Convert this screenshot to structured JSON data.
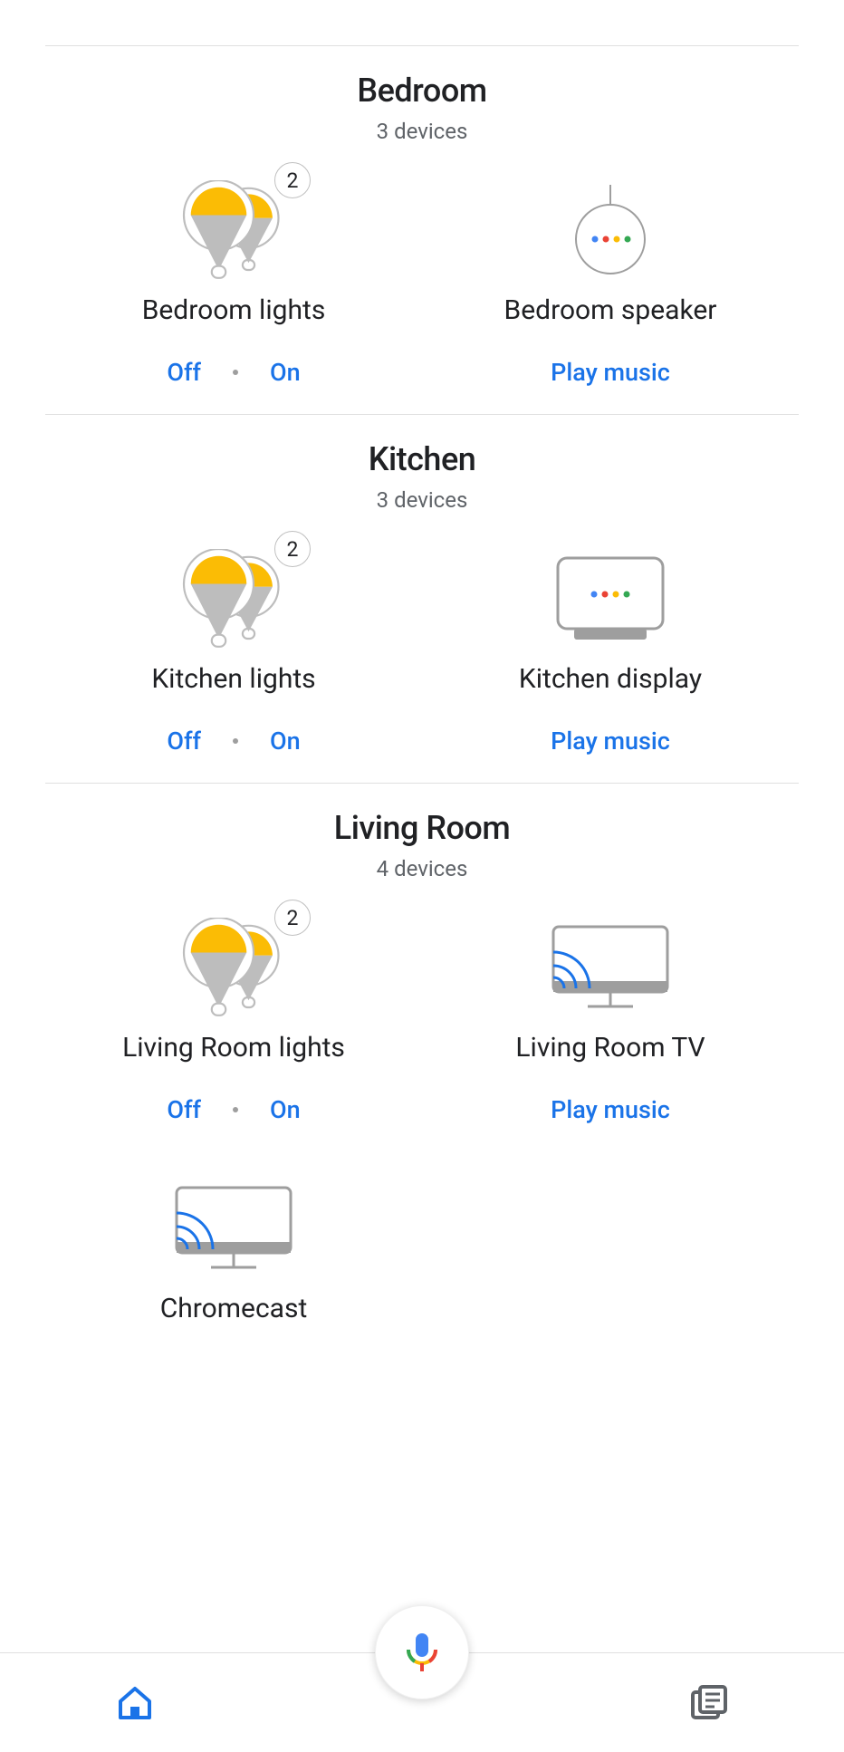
{
  "rooms": [
    {
      "name": "Bedroom",
      "subtitle": "3 devices",
      "devices": [
        {
          "name": "Bedroom lights",
          "icon": "bulb-group",
          "badge": "2",
          "actions": [
            "Off",
            "On"
          ]
        },
        {
          "name": "Bedroom speaker",
          "icon": "google-mini",
          "action": "Play music"
        }
      ]
    },
    {
      "name": "Kitchen",
      "subtitle": "3 devices",
      "devices": [
        {
          "name": "Kitchen lights",
          "icon": "bulb-group",
          "badge": "2",
          "actions": [
            "Off",
            "On"
          ]
        },
        {
          "name": "Kitchen display",
          "icon": "nest-hub",
          "action": "Play music"
        }
      ]
    },
    {
      "name": "Living Room",
      "subtitle": "4 devices",
      "devices": [
        {
          "name": "Living Room lights",
          "icon": "bulb-group",
          "badge": "2",
          "actions": [
            "Off",
            "On"
          ]
        },
        {
          "name": "Living Room TV",
          "icon": "cast-tv",
          "action": "Play music"
        }
      ],
      "extra": [
        {
          "name": "Chromecast",
          "icon": "cast-tv"
        }
      ]
    }
  ],
  "colors": {
    "blue": "#4285F4",
    "red": "#EA4335",
    "yellow": "#FBBC05",
    "green": "#34A853",
    "bulb": "#FBBC05"
  }
}
